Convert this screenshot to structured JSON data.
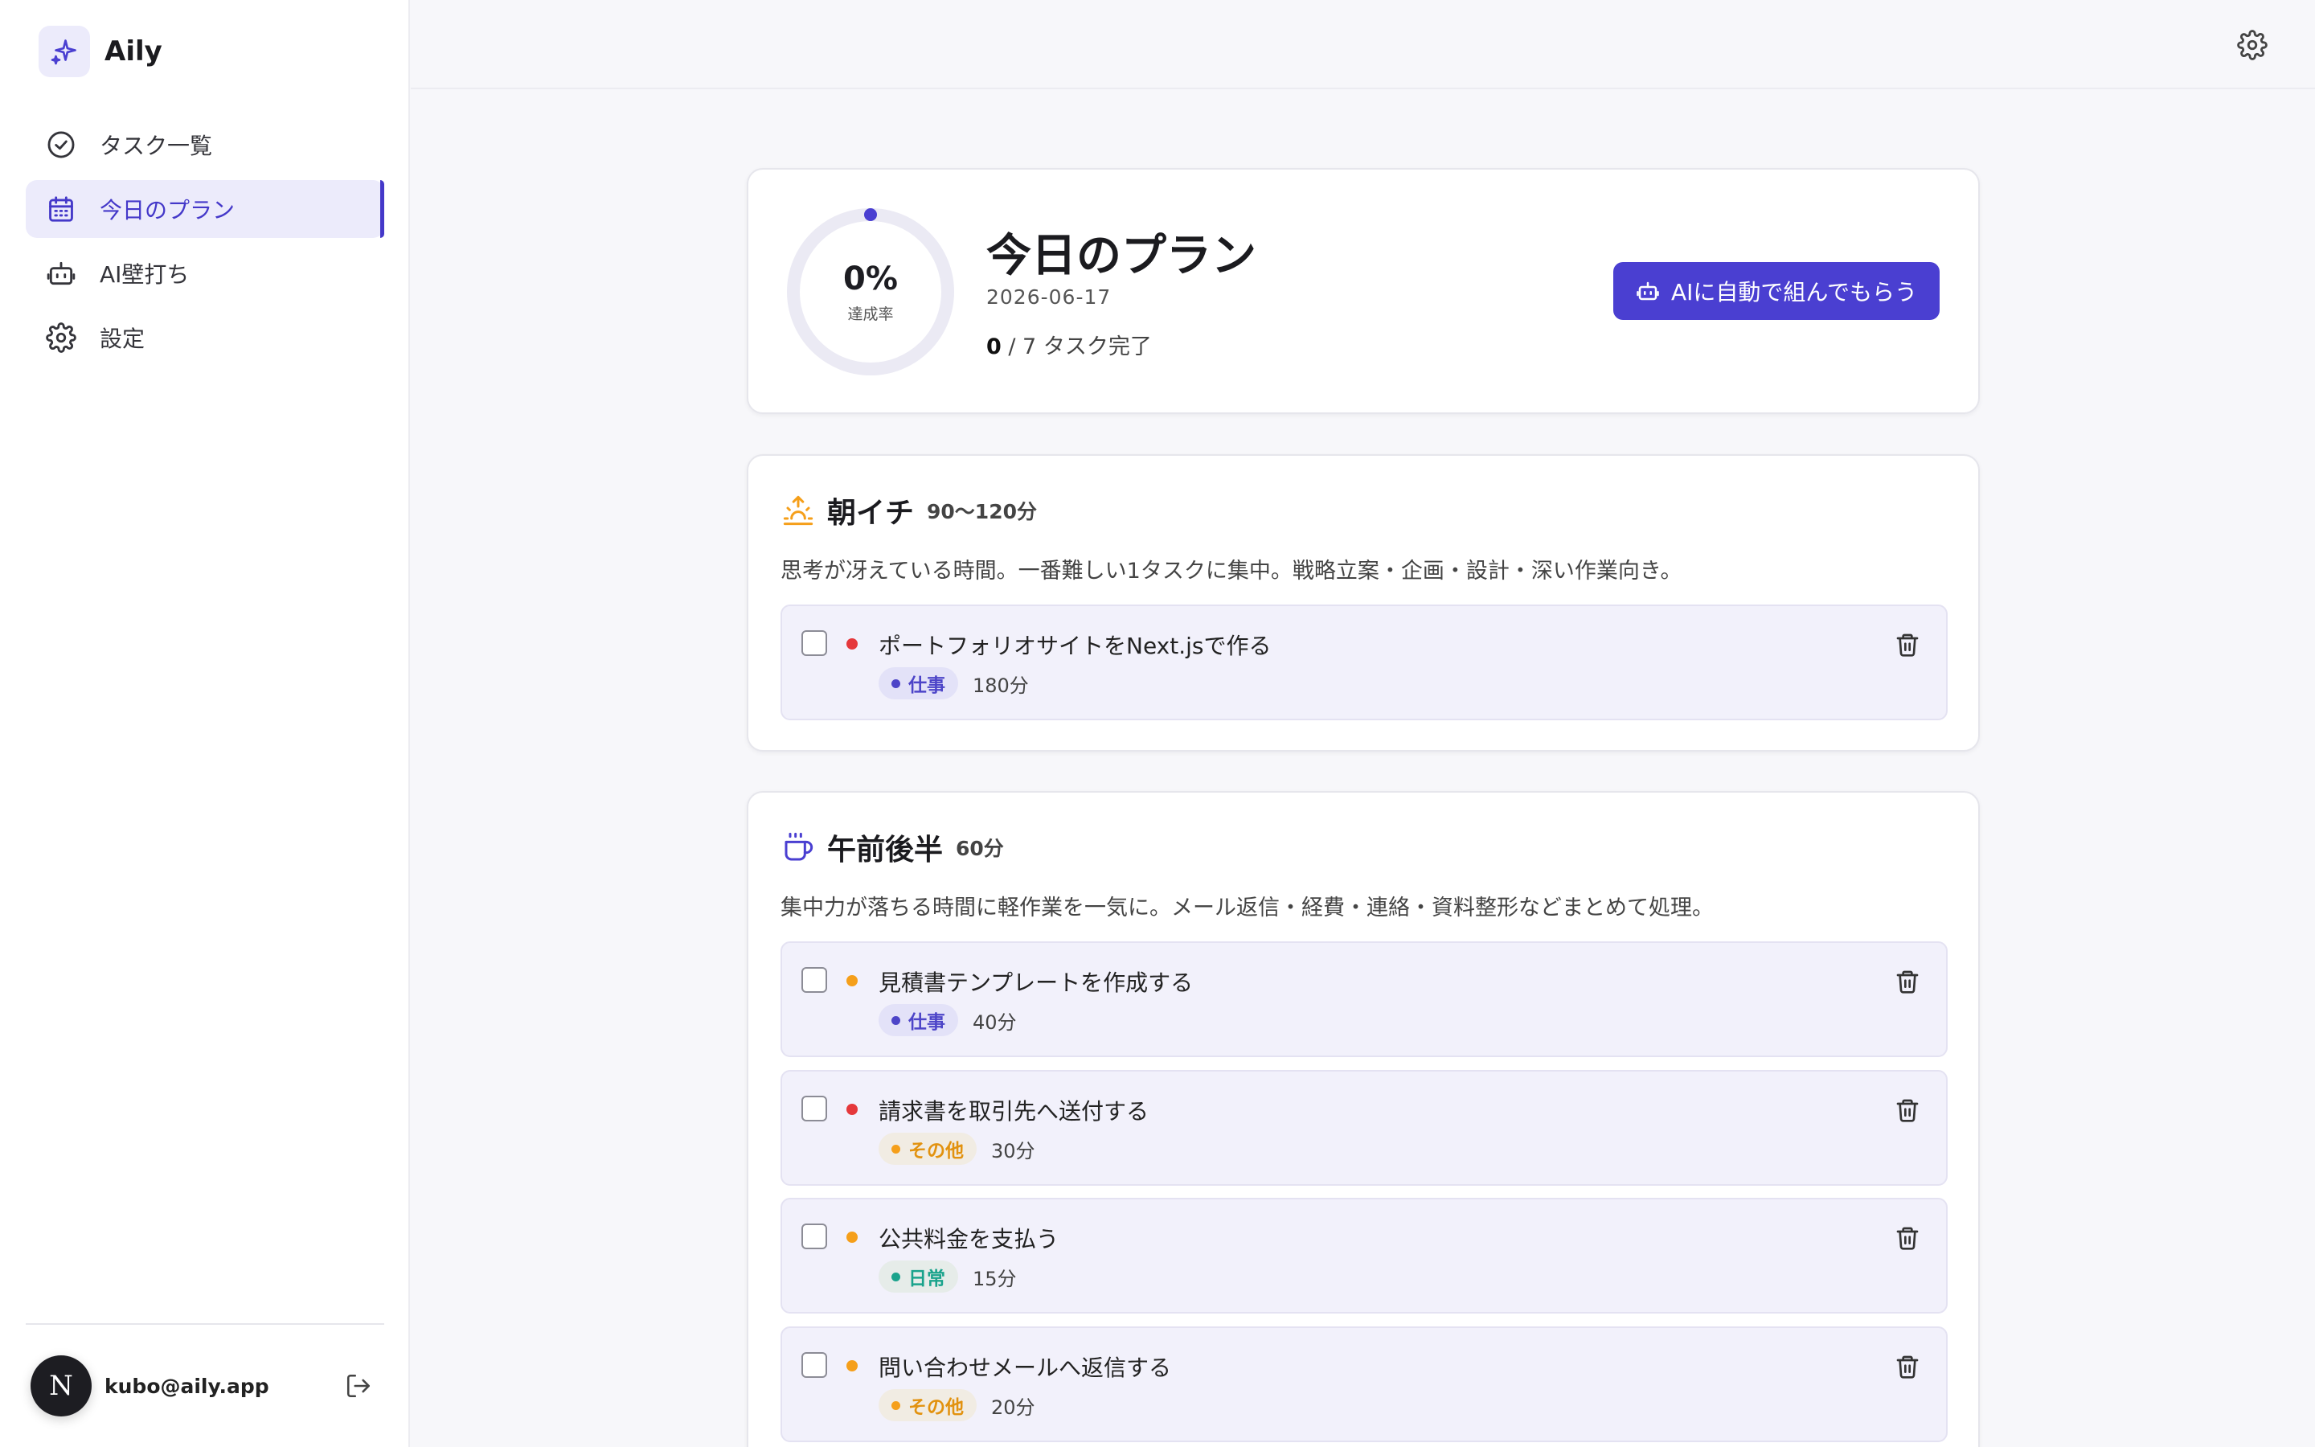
{
  "app": {
    "name": "Aily"
  },
  "sidebar": {
    "items": [
      {
        "label": "タスク一覧",
        "icon": "check-circle-icon",
        "active": false
      },
      {
        "label": "今日のプラン",
        "icon": "calendar-icon",
        "active": true
      },
      {
        "label": "AI壁打ち",
        "icon": "bot-icon",
        "active": false
      },
      {
        "label": "設定",
        "icon": "gear-icon",
        "active": false
      }
    ],
    "user": {
      "avatar_letter": "N",
      "email": "kubo@aily.app"
    }
  },
  "summary": {
    "percent_text": "0%",
    "percent_value": 0,
    "percent_label": "達成率",
    "title": "今日のプラン",
    "date": "2026-06-17",
    "done_count": "0",
    "total_text": " / 7 タスク完了",
    "auto_button": "AIに自動で組んでもらう"
  },
  "sections": [
    {
      "icon": "sunrise-icon",
      "title": "朝イチ",
      "duration": "90〜120分",
      "description": "思考が冴えている時間。一番難しい1タスクに集中。戦略立案・企画・設計・深い作業向き。",
      "tasks": [
        {
          "title": "ポートフォリオサイトをNext.jsで作る",
          "priority": "high",
          "tag": "仕事",
          "tag_type": "work",
          "minutes": "180分"
        }
      ]
    },
    {
      "icon": "coffee-icon",
      "title": "午前後半",
      "duration": "60分",
      "description": "集中力が落ちる時間に軽作業を一気に。メール返信・経費・連絡・資料整形などまとめて処理。",
      "tasks": [
        {
          "title": "見積書テンプレートを作成する",
          "priority": "medium",
          "tag": "仕事",
          "tag_type": "work",
          "minutes": "40分"
        },
        {
          "title": "請求書を取引先へ送付する",
          "priority": "high",
          "tag": "その他",
          "tag_type": "other",
          "minutes": "30分"
        },
        {
          "title": "公共料金を支払う",
          "priority": "medium",
          "tag": "日常",
          "tag_type": "daily",
          "minutes": "15分"
        },
        {
          "title": "問い合わせメールへ返信する",
          "priority": "medium",
          "tag": "その他",
          "tag_type": "other",
          "minutes": "20分"
        }
      ]
    }
  ],
  "colors": {
    "accent": "#4a3fd1",
    "priority_high": "#e5383b",
    "priority_medium": "#f59f1a",
    "tag_work_bg": "#e3e2f8",
    "tag_work_fg": "#4d45c8",
    "tag_other_bg": "#f1ece3",
    "tag_other_fg": "#e2920f",
    "tag_daily_bg": "#e6ece9",
    "tag_daily_fg": "#1aa38c"
  }
}
